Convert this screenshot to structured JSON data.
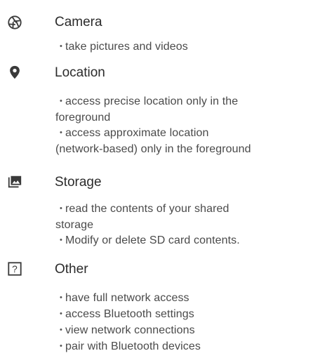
{
  "groups": [
    {
      "icon": "camera-aperture-icon",
      "title": "Camera",
      "items": [
        [
          "take pictures and videos"
        ]
      ]
    },
    {
      "icon": "location-pin-icon",
      "title": "Location",
      "items": [
        [
          "access precise location only in the",
          "foreground"
        ],
        [
          "access approximate location",
          "(network-based) only in the foreground"
        ]
      ]
    },
    {
      "icon": "photo-folder-icon",
      "title": "Storage",
      "items": [
        [
          "read the contents of your shared",
          "storage"
        ],
        [
          "Modify or delete SD card contents."
        ]
      ]
    },
    {
      "icon": "question-box-icon",
      "title": "Other",
      "items": [
        [
          "have full network access"
        ],
        [
          "access Bluetooth settings"
        ],
        [
          "view network connections"
        ],
        [
          "pair with Bluetooth devices"
        ]
      ]
    }
  ]
}
